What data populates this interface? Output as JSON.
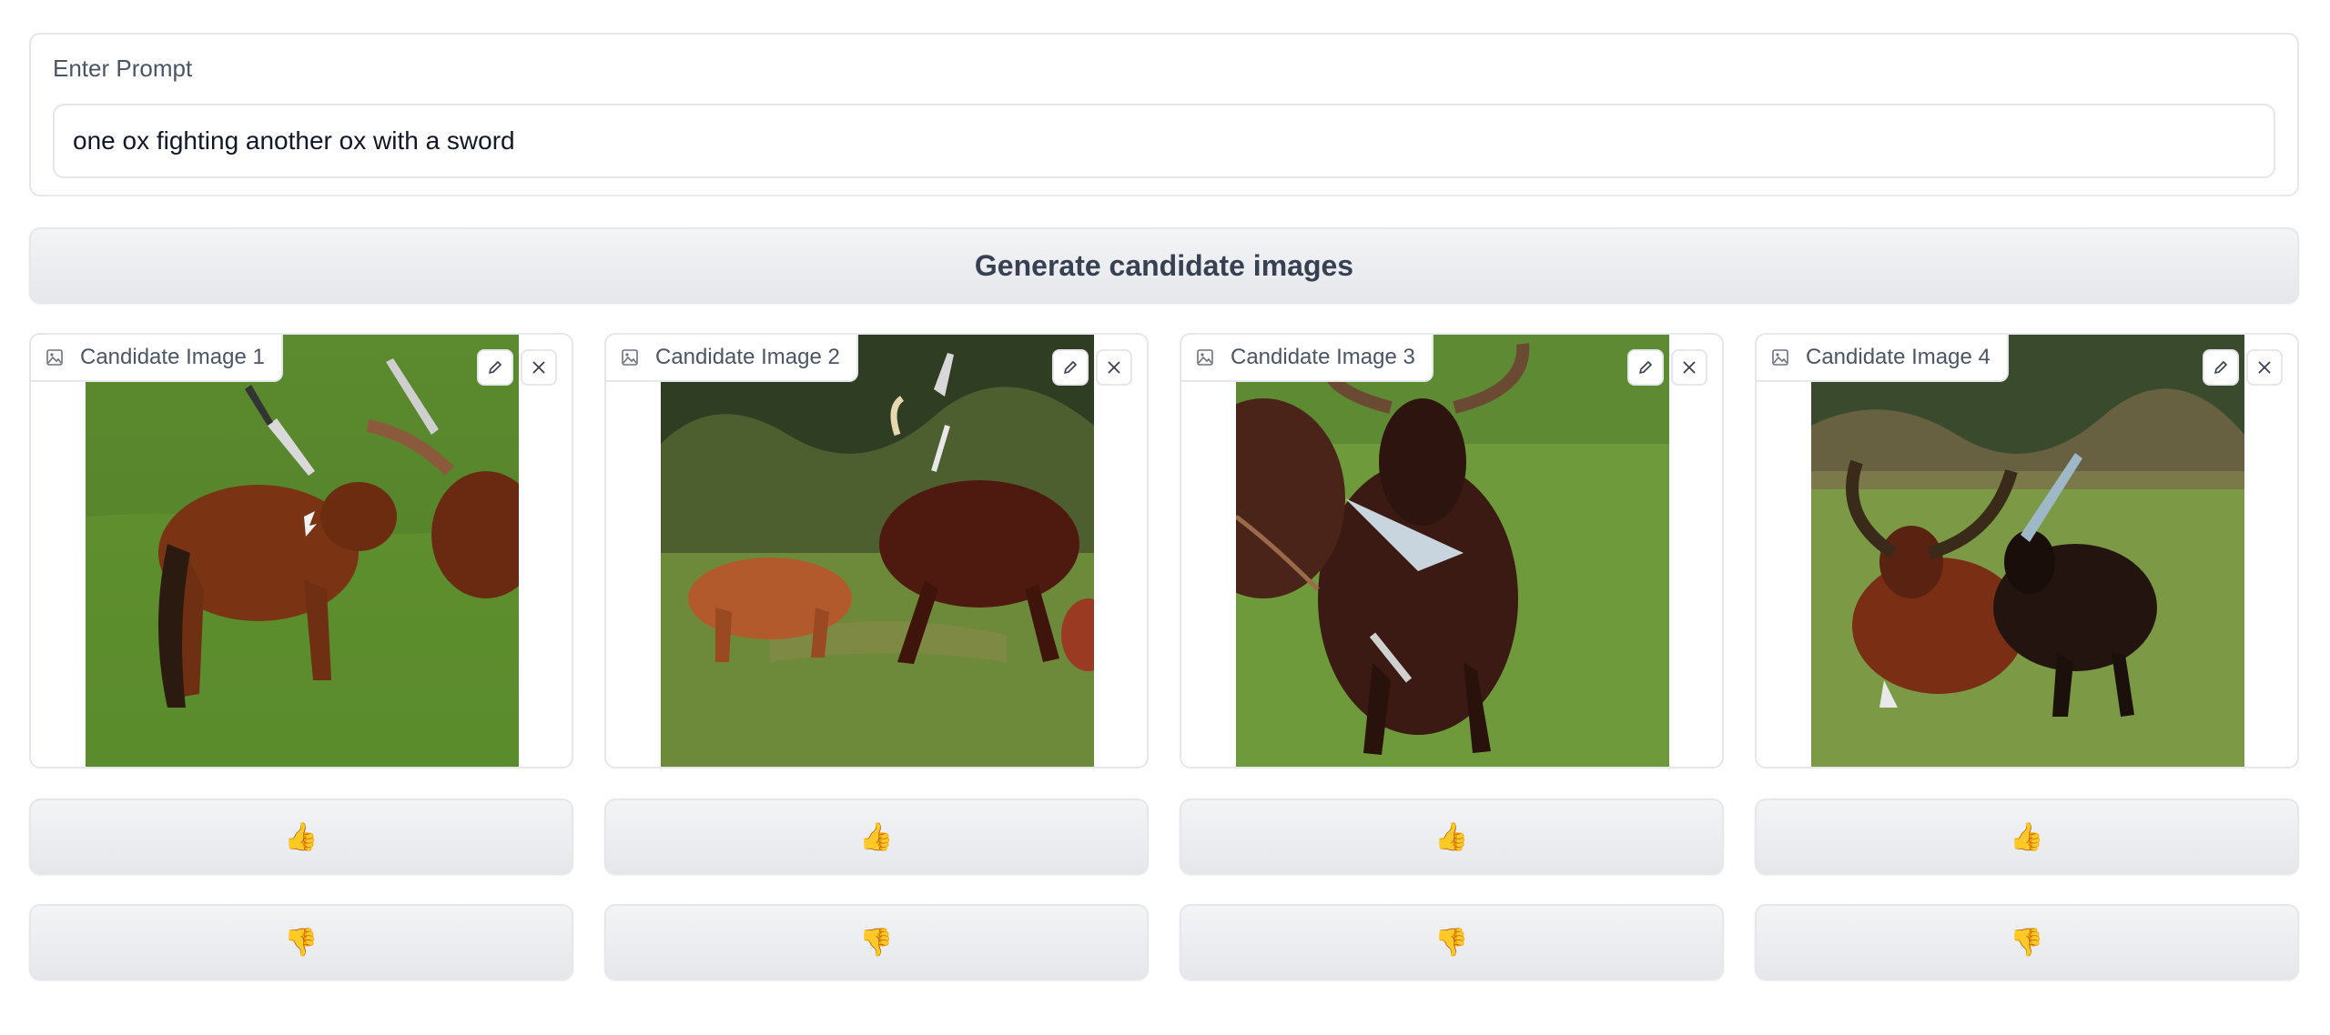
{
  "prompt": {
    "label": "Enter Prompt",
    "value": "one ox fighting another ox with a sword"
  },
  "generate_button": {
    "label": "Generate candidate images"
  },
  "candidates": [
    {
      "label": "Candidate Image 1",
      "image_description_icon": "image-icon"
    },
    {
      "label": "Candidate Image 2",
      "image_description_icon": "image-icon"
    },
    {
      "label": "Candidate Image 3",
      "image_description_icon": "image-icon"
    },
    {
      "label": "Candidate Image 4",
      "image_description_icon": "image-icon"
    }
  ],
  "vote": {
    "thumbs_up": "👍",
    "thumbs_down": "👎"
  },
  "icons": {
    "edit": "pencil-icon",
    "clear": "close-icon",
    "image": "image-icon"
  },
  "colors": {
    "border": "#e5e7eb",
    "button_bg": "#e5e7eb",
    "text": "#374151"
  }
}
